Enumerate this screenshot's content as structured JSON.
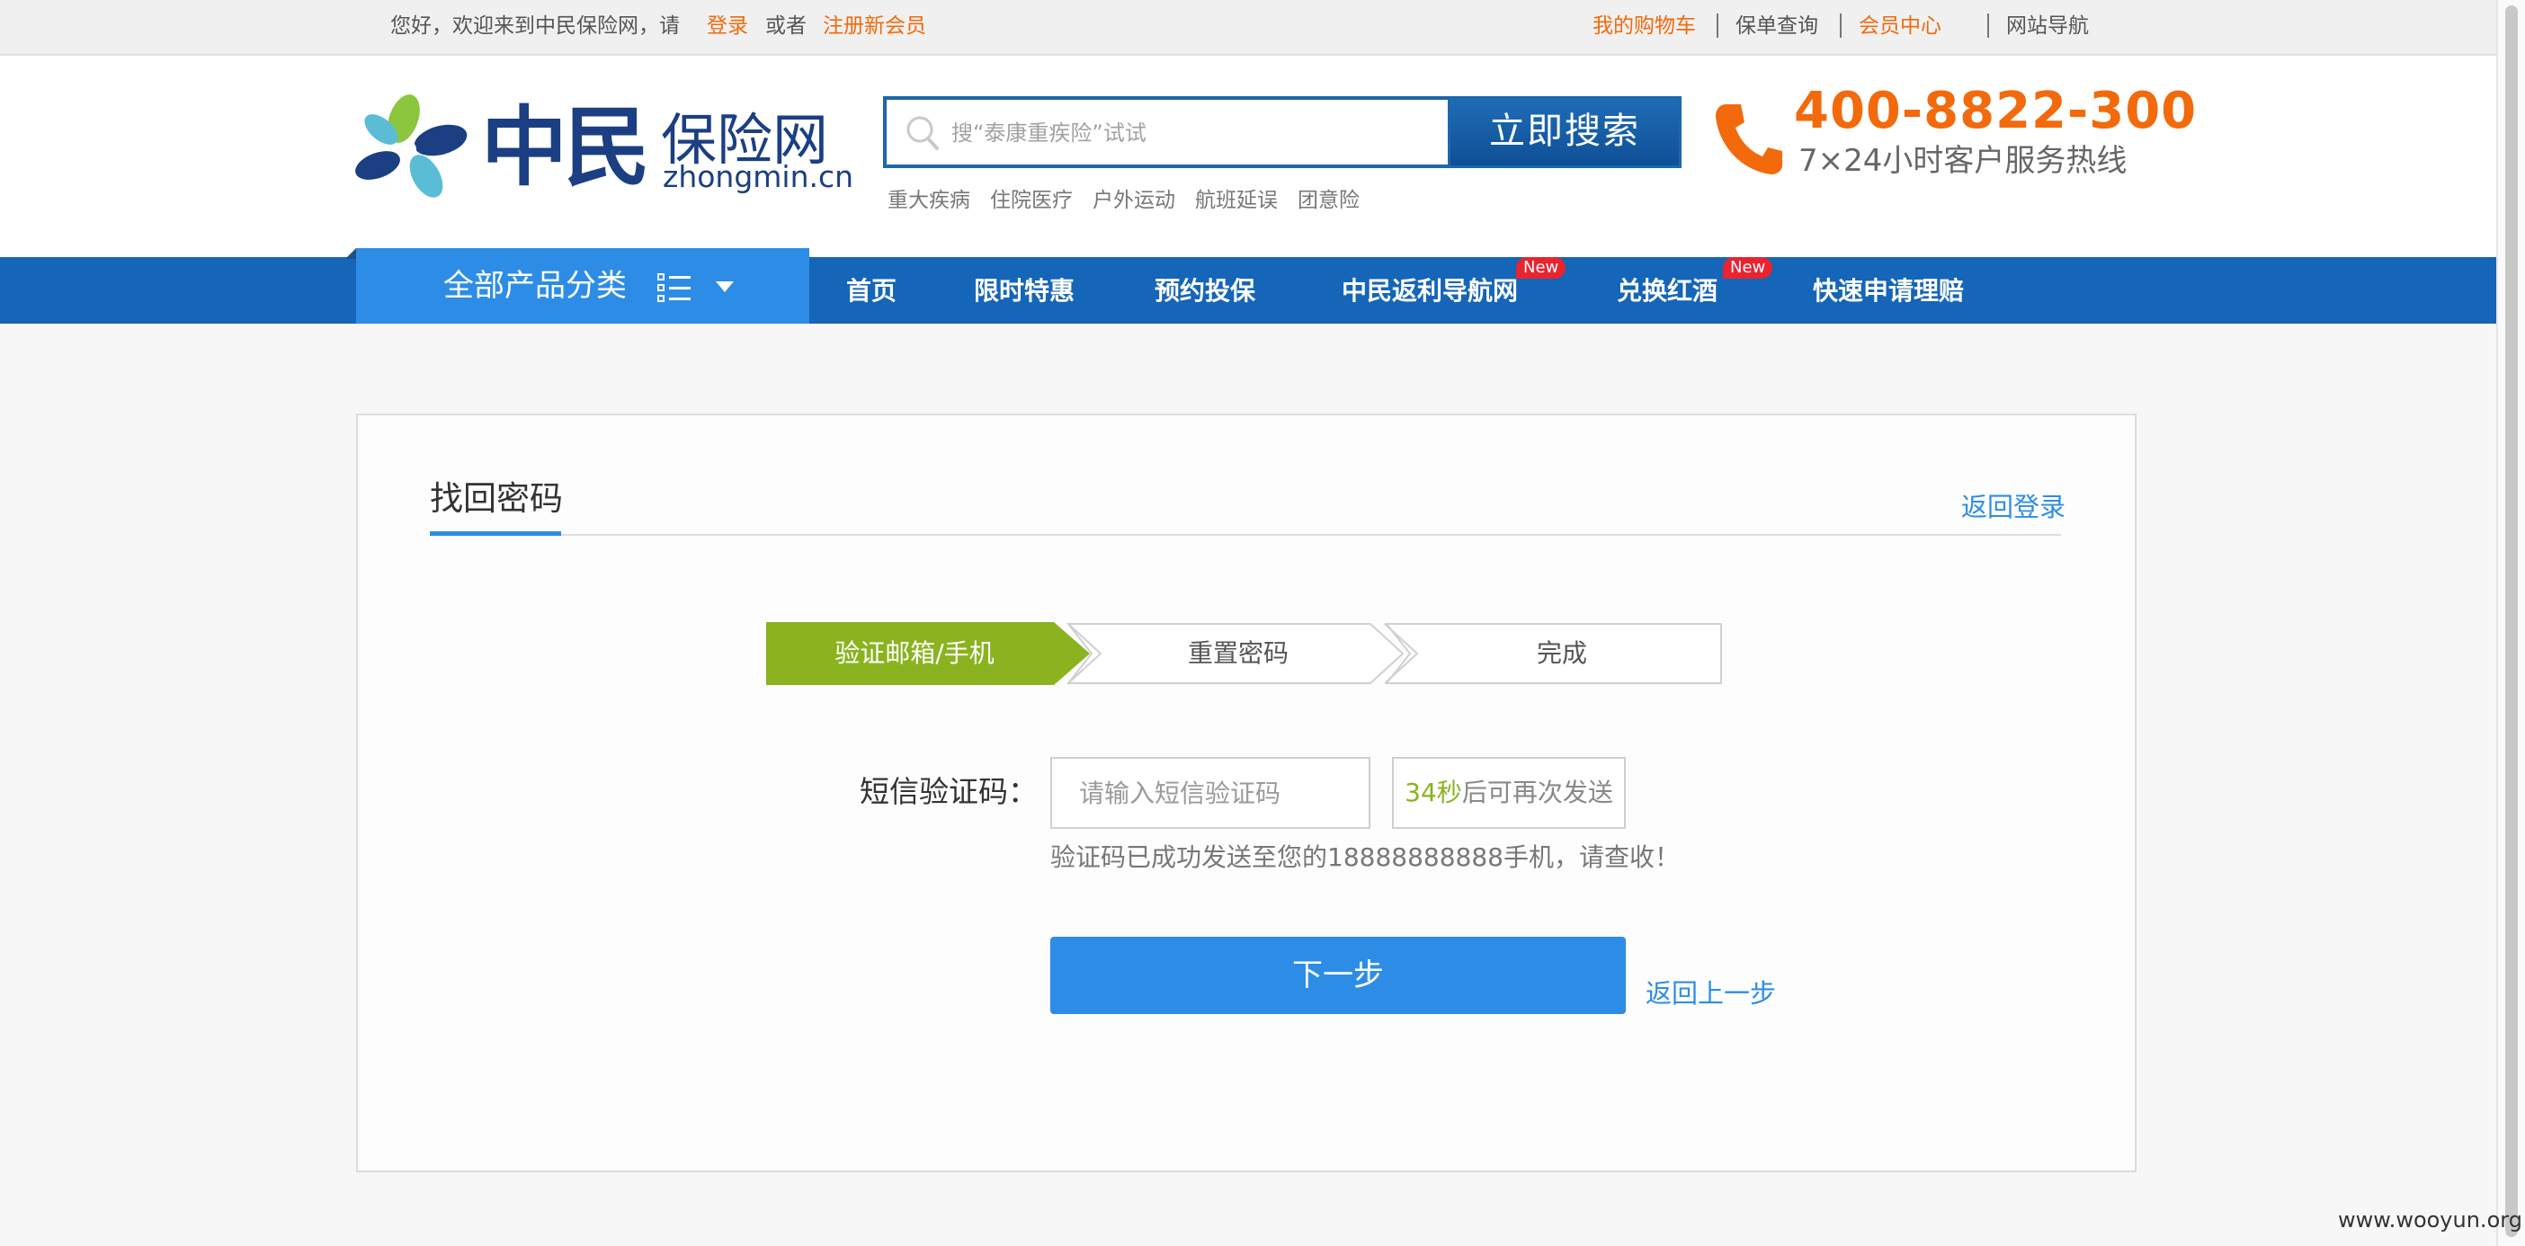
{
  "topbar": {
    "greeting": "您好，欢迎来到中民保险网，请",
    "login": "登录",
    "or": "或者",
    "register": "注册新会员",
    "cart": "我的购物车",
    "policy_query": "保单查询",
    "member_center": "会员中心",
    "site_nav": "网站导航"
  },
  "logo": {
    "main": "中民",
    "sub": "保险网",
    "domain": "zhongmin.cn"
  },
  "search": {
    "placeholder": "搜“泰康重疾险”试试",
    "button": "立即搜索",
    "hotwords": [
      "重大疾病",
      "住院医疗",
      "户外运动",
      "航班延误",
      "团意险"
    ]
  },
  "hotline": {
    "number": "400-8822-300",
    "desc": "7×24小时客户服务热线"
  },
  "nav": {
    "category": "全部产品分类",
    "items": [
      "首页",
      "限时特惠",
      "预约投保",
      "中民返利导航网",
      "兑换红酒",
      "快速申请理赔"
    ],
    "badge": "New"
  },
  "page": {
    "title": "找回密码",
    "back_login": "返回登录",
    "steps": [
      "验证邮箱/手机",
      "重置密码",
      "完成"
    ],
    "sms_label": "短信验证码：",
    "sms_placeholder": "请输入短信验证码",
    "countdown": "34秒",
    "resend_suffix": "后可再次发送",
    "sent_message": "验证码已成功发送至您的18888888888手机，请查收！",
    "next": "下一步",
    "back_step": "返回上一步"
  },
  "watermark": "www.wooyun.org",
  "colors": {
    "brand_blue": "#1565b8",
    "accent_blue": "#2d8de6",
    "orange": "#f26a0c",
    "step_green": "#8ab31f"
  }
}
